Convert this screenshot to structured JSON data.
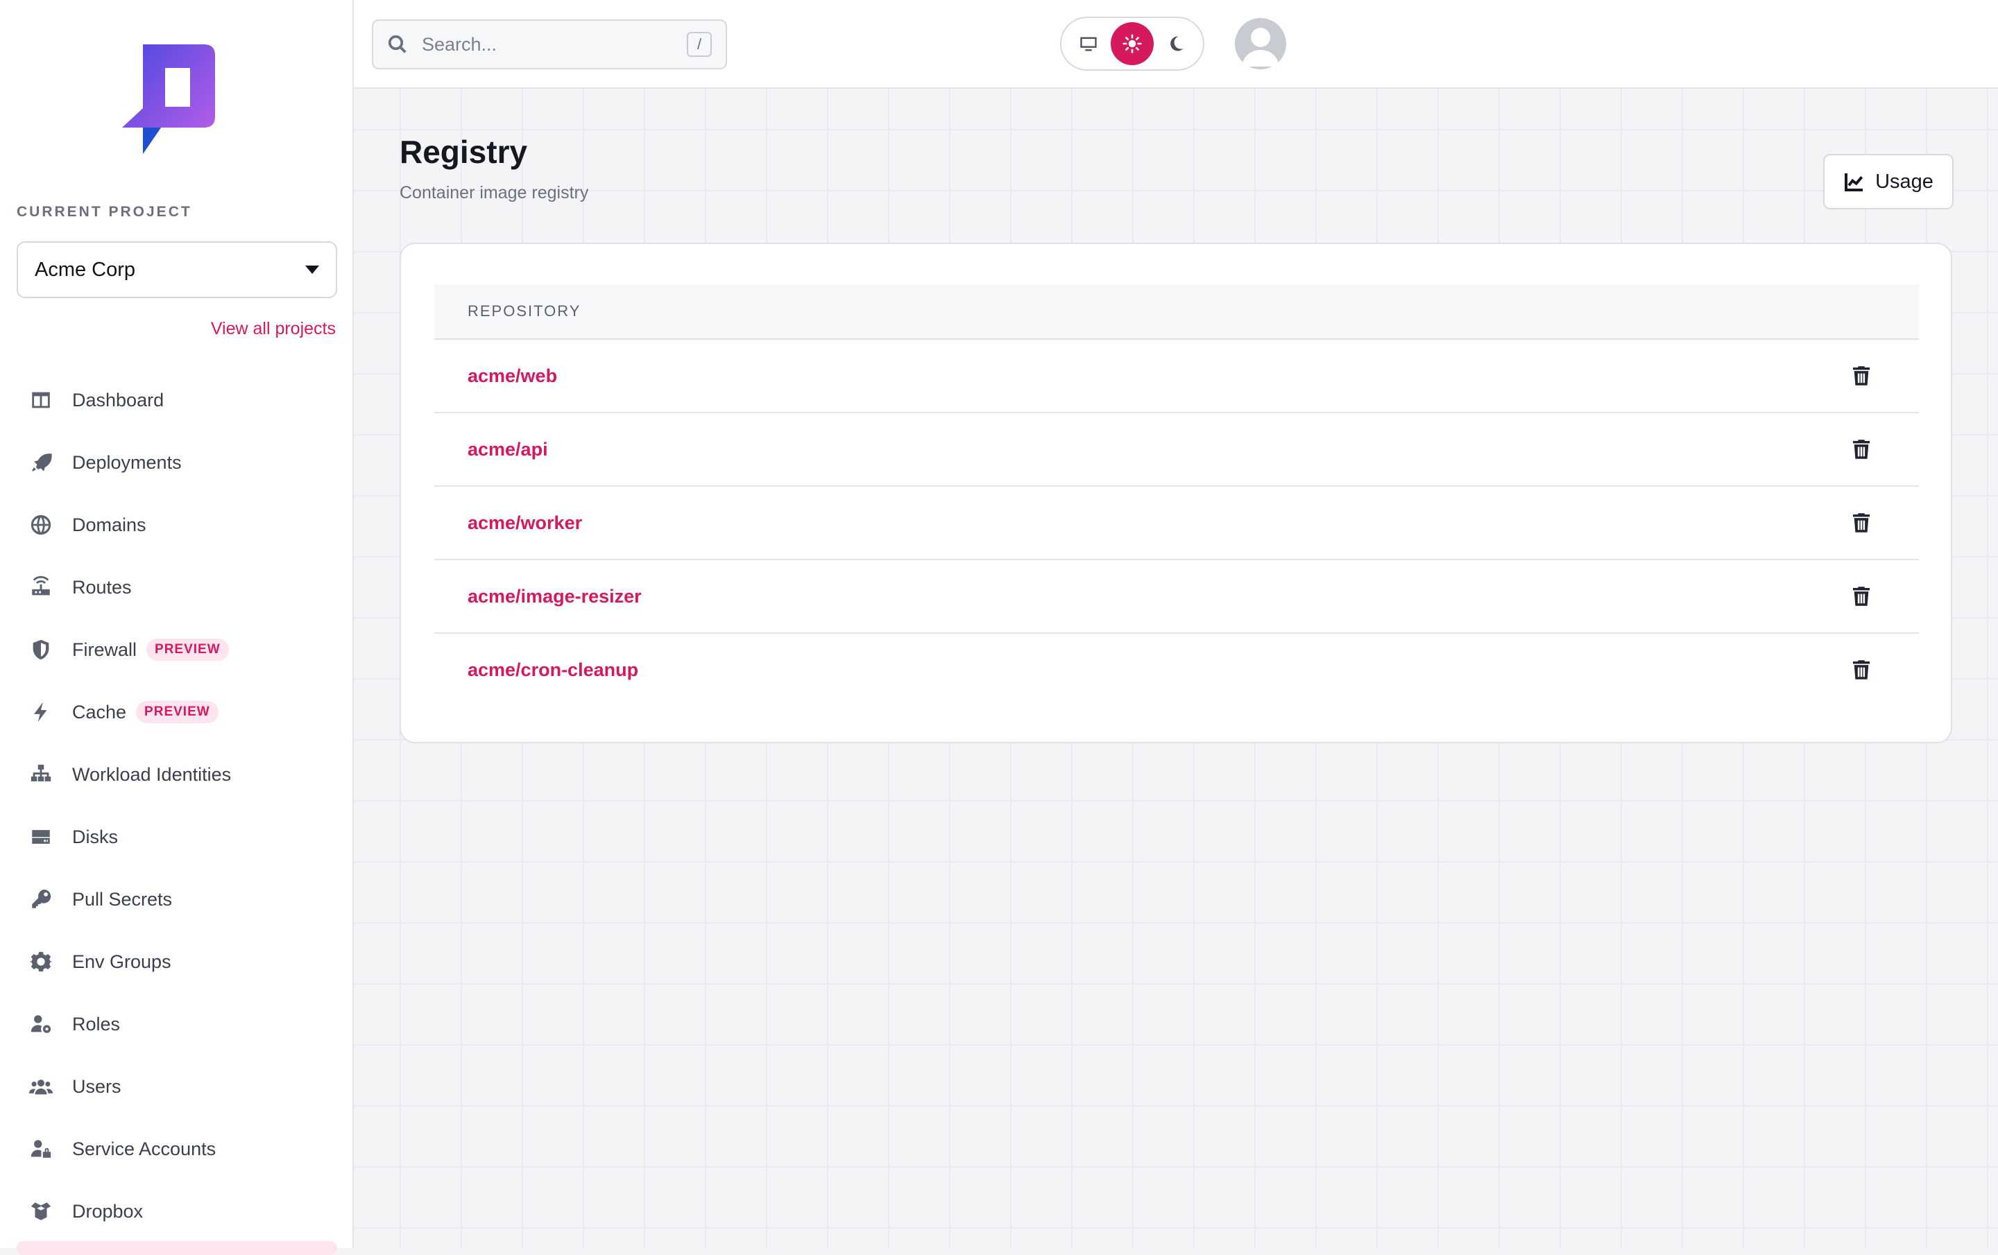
{
  "sidebar": {
    "current_project_label": "CURRENT PROJECT",
    "project_name": "Acme Corp",
    "view_all_projects": "View all projects",
    "items": [
      {
        "label": "Dashboard",
        "icon": "dashboard-icon"
      },
      {
        "label": "Deployments",
        "icon": "rocket-icon"
      },
      {
        "label": "Domains",
        "icon": "globe-icon"
      },
      {
        "label": "Routes",
        "icon": "router-icon"
      },
      {
        "label": "Firewall",
        "icon": "shield-icon",
        "badge": "PREVIEW"
      },
      {
        "label": "Cache",
        "icon": "bolt-icon",
        "badge": "PREVIEW"
      },
      {
        "label": "Workload Identities",
        "icon": "network-icon"
      },
      {
        "label": "Disks",
        "icon": "disk-icon"
      },
      {
        "label": "Pull Secrets",
        "icon": "key-icon"
      },
      {
        "label": "Env Groups",
        "icon": "gear-icon"
      },
      {
        "label": "Roles",
        "icon": "user-gear-icon"
      },
      {
        "label": "Users",
        "icon": "users-icon"
      },
      {
        "label": "Service Accounts",
        "icon": "user-lock-icon"
      },
      {
        "label": "Dropbox",
        "icon": "box-icon"
      }
    ]
  },
  "topbar": {
    "search_placeholder": "Search...",
    "search_shortcut": "/",
    "theme_options": [
      "monitor-icon",
      "sun-icon",
      "moon-icon"
    ],
    "theme_selected": "sun-icon"
  },
  "page": {
    "title": "Registry",
    "subtitle": "Container image registry",
    "usage_button": "Usage"
  },
  "table": {
    "header": "REPOSITORY",
    "rows": [
      {
        "name": "acme/web"
      },
      {
        "name": "acme/api"
      },
      {
        "name": "acme/worker"
      },
      {
        "name": "acme/image-resizer"
      },
      {
        "name": "acme/cron-cleanup"
      }
    ]
  },
  "colors": {
    "accent": "#d6195f",
    "accent_soft": "#fde4ee",
    "logo_gradient": [
      "#5b3bd8",
      "#c060e8"
    ]
  }
}
